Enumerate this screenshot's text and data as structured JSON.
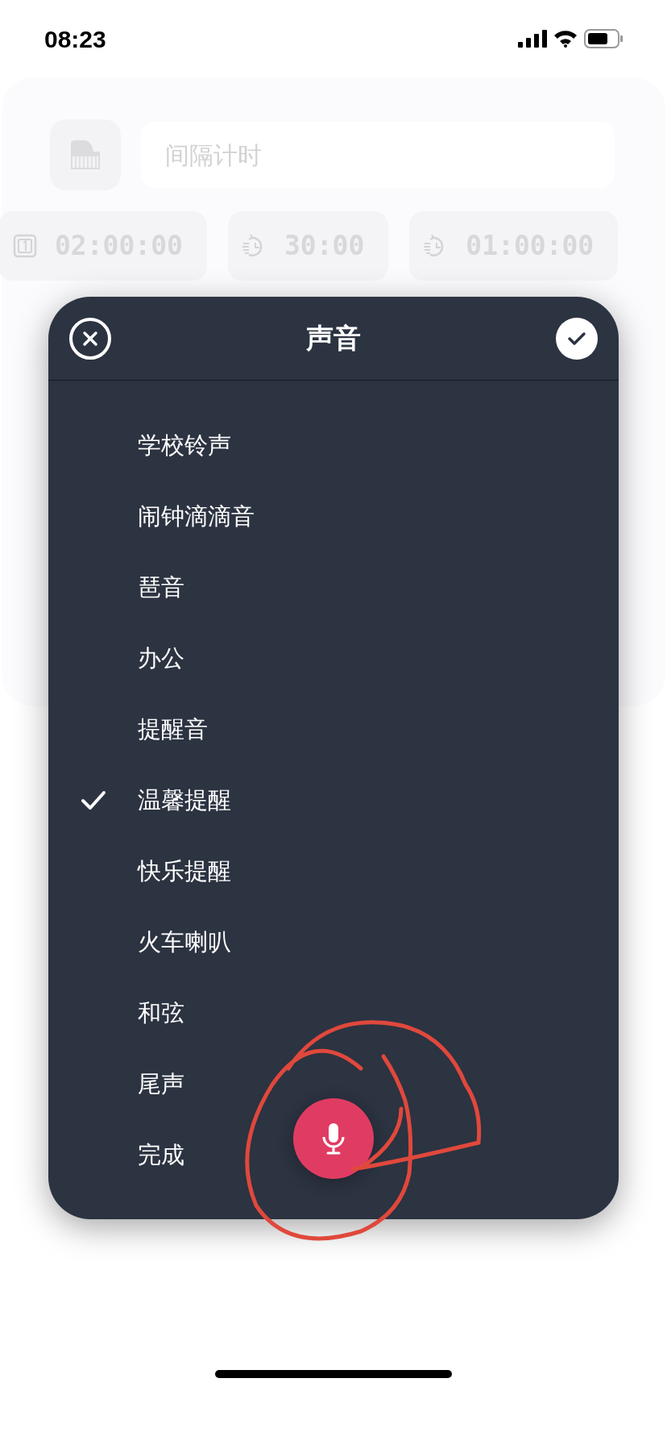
{
  "status_bar": {
    "time": "08:23"
  },
  "background": {
    "name_field": {
      "placeholder": "间隔计时"
    },
    "timers": [
      {
        "kind": "counter",
        "value": "02:00:00"
      },
      {
        "kind": "timer",
        "value": "30:00"
      },
      {
        "kind": "timer",
        "value": "01:00:00"
      }
    ]
  },
  "dialog": {
    "title": "声音",
    "items": [
      {
        "label": "学校铃声",
        "selected": false
      },
      {
        "label": "闹钟滴滴音",
        "selected": false
      },
      {
        "label": "琶音",
        "selected": false
      },
      {
        "label": "办公",
        "selected": false
      },
      {
        "label": "提醒音",
        "selected": false
      },
      {
        "label": "温馨提醒",
        "selected": true
      },
      {
        "label": "快乐提醒",
        "selected": false
      },
      {
        "label": "火车喇叭",
        "selected": false
      },
      {
        "label": "和弦",
        "selected": false
      },
      {
        "label": "尾声",
        "selected": false
      },
      {
        "label": "完成",
        "selected": false
      }
    ]
  }
}
